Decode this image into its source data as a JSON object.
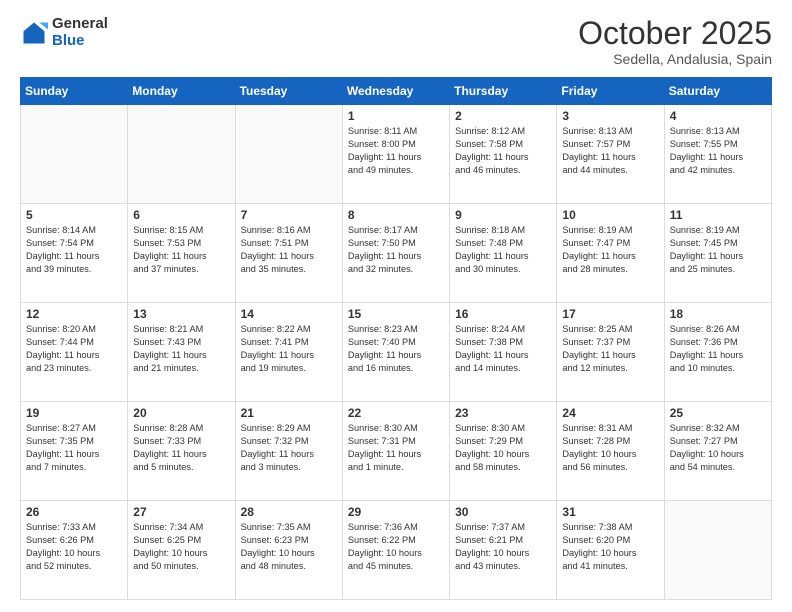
{
  "logo": {
    "general": "General",
    "blue": "Blue"
  },
  "header": {
    "month": "October 2025",
    "location": "Sedella, Andalusia, Spain"
  },
  "weekdays": [
    "Sunday",
    "Monday",
    "Tuesday",
    "Wednesday",
    "Thursday",
    "Friday",
    "Saturday"
  ],
  "weeks": [
    [
      {
        "day": "",
        "info": ""
      },
      {
        "day": "",
        "info": ""
      },
      {
        "day": "",
        "info": ""
      },
      {
        "day": "1",
        "info": "Sunrise: 8:11 AM\nSunset: 8:00 PM\nDaylight: 11 hours\nand 49 minutes."
      },
      {
        "day": "2",
        "info": "Sunrise: 8:12 AM\nSunset: 7:58 PM\nDaylight: 11 hours\nand 46 minutes."
      },
      {
        "day": "3",
        "info": "Sunrise: 8:13 AM\nSunset: 7:57 PM\nDaylight: 11 hours\nand 44 minutes."
      },
      {
        "day": "4",
        "info": "Sunrise: 8:13 AM\nSunset: 7:55 PM\nDaylight: 11 hours\nand 42 minutes."
      }
    ],
    [
      {
        "day": "5",
        "info": "Sunrise: 8:14 AM\nSunset: 7:54 PM\nDaylight: 11 hours\nand 39 minutes."
      },
      {
        "day": "6",
        "info": "Sunrise: 8:15 AM\nSunset: 7:53 PM\nDaylight: 11 hours\nand 37 minutes."
      },
      {
        "day": "7",
        "info": "Sunrise: 8:16 AM\nSunset: 7:51 PM\nDaylight: 11 hours\nand 35 minutes."
      },
      {
        "day": "8",
        "info": "Sunrise: 8:17 AM\nSunset: 7:50 PM\nDaylight: 11 hours\nand 32 minutes."
      },
      {
        "day": "9",
        "info": "Sunrise: 8:18 AM\nSunset: 7:48 PM\nDaylight: 11 hours\nand 30 minutes."
      },
      {
        "day": "10",
        "info": "Sunrise: 8:19 AM\nSunset: 7:47 PM\nDaylight: 11 hours\nand 28 minutes."
      },
      {
        "day": "11",
        "info": "Sunrise: 8:19 AM\nSunset: 7:45 PM\nDaylight: 11 hours\nand 25 minutes."
      }
    ],
    [
      {
        "day": "12",
        "info": "Sunrise: 8:20 AM\nSunset: 7:44 PM\nDaylight: 11 hours\nand 23 minutes."
      },
      {
        "day": "13",
        "info": "Sunrise: 8:21 AM\nSunset: 7:43 PM\nDaylight: 11 hours\nand 21 minutes."
      },
      {
        "day": "14",
        "info": "Sunrise: 8:22 AM\nSunset: 7:41 PM\nDaylight: 11 hours\nand 19 minutes."
      },
      {
        "day": "15",
        "info": "Sunrise: 8:23 AM\nSunset: 7:40 PM\nDaylight: 11 hours\nand 16 minutes."
      },
      {
        "day": "16",
        "info": "Sunrise: 8:24 AM\nSunset: 7:38 PM\nDaylight: 11 hours\nand 14 minutes."
      },
      {
        "day": "17",
        "info": "Sunrise: 8:25 AM\nSunset: 7:37 PM\nDaylight: 11 hours\nand 12 minutes."
      },
      {
        "day": "18",
        "info": "Sunrise: 8:26 AM\nSunset: 7:36 PM\nDaylight: 11 hours\nand 10 minutes."
      }
    ],
    [
      {
        "day": "19",
        "info": "Sunrise: 8:27 AM\nSunset: 7:35 PM\nDaylight: 11 hours\nand 7 minutes."
      },
      {
        "day": "20",
        "info": "Sunrise: 8:28 AM\nSunset: 7:33 PM\nDaylight: 11 hours\nand 5 minutes."
      },
      {
        "day": "21",
        "info": "Sunrise: 8:29 AM\nSunset: 7:32 PM\nDaylight: 11 hours\nand 3 minutes."
      },
      {
        "day": "22",
        "info": "Sunrise: 8:30 AM\nSunset: 7:31 PM\nDaylight: 11 hours\nand 1 minute."
      },
      {
        "day": "23",
        "info": "Sunrise: 8:30 AM\nSunset: 7:29 PM\nDaylight: 10 hours\nand 58 minutes."
      },
      {
        "day": "24",
        "info": "Sunrise: 8:31 AM\nSunset: 7:28 PM\nDaylight: 10 hours\nand 56 minutes."
      },
      {
        "day": "25",
        "info": "Sunrise: 8:32 AM\nSunset: 7:27 PM\nDaylight: 10 hours\nand 54 minutes."
      }
    ],
    [
      {
        "day": "26",
        "info": "Sunrise: 7:33 AM\nSunset: 6:26 PM\nDaylight: 10 hours\nand 52 minutes."
      },
      {
        "day": "27",
        "info": "Sunrise: 7:34 AM\nSunset: 6:25 PM\nDaylight: 10 hours\nand 50 minutes."
      },
      {
        "day": "28",
        "info": "Sunrise: 7:35 AM\nSunset: 6:23 PM\nDaylight: 10 hours\nand 48 minutes."
      },
      {
        "day": "29",
        "info": "Sunrise: 7:36 AM\nSunset: 6:22 PM\nDaylight: 10 hours\nand 45 minutes."
      },
      {
        "day": "30",
        "info": "Sunrise: 7:37 AM\nSunset: 6:21 PM\nDaylight: 10 hours\nand 43 minutes."
      },
      {
        "day": "31",
        "info": "Sunrise: 7:38 AM\nSunset: 6:20 PM\nDaylight: 10 hours\nand 41 minutes."
      },
      {
        "day": "",
        "info": ""
      }
    ]
  ]
}
